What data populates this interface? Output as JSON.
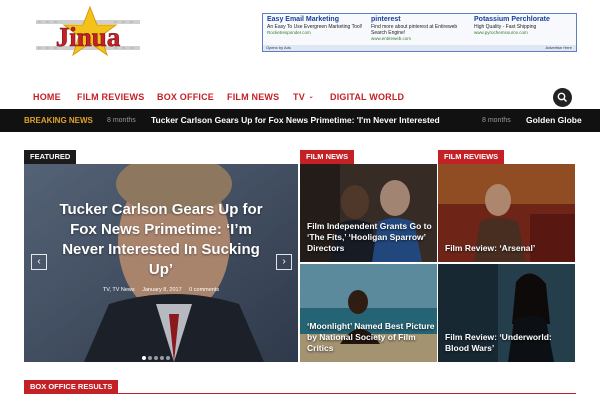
{
  "header": {
    "logo_text": "Jinua"
  },
  "ad": {
    "columns": [
      {
        "title": "Easy Email Marketing",
        "desc": "An Easy To Use Evergreen Marketing Tool!",
        "url": "Rocketresponder.com"
      },
      {
        "title": "pinterest",
        "desc": "Find more about pinterest at Entireweb Search Engine!",
        "url": "www.entireweb.com"
      },
      {
        "title": "Potassium Perchlorate",
        "desc": "High Quality - Fast Shipping",
        "url": "www.pyrochemsource.com"
      }
    ],
    "footer_left": "Openx by Ads",
    "footer_right": "Advertise Here"
  },
  "nav": {
    "items": [
      {
        "label": "HOME"
      },
      {
        "label": "FILM REVIEWS"
      },
      {
        "label": "BOX OFFICE"
      },
      {
        "label": "FILM NEWS"
      },
      {
        "label": "TV"
      },
      {
        "label": "DIGITAL WORLD"
      }
    ]
  },
  "breaking": {
    "label": "BREAKING NEWS",
    "items": [
      {
        "time": "8 months",
        "title": "Tucker Carlson Gears Up for Fox News Primetime: 'I'm Never Interested In"
      },
      {
        "time": "8 months",
        "title": "Golden Globe"
      }
    ]
  },
  "featured": {
    "label": "FEATURED",
    "title": "Tucker Carlson Gears Up for Fox News Primetime: ‘I’m Never Interested In Sucking Up’",
    "categories": "TV, TV News",
    "date": "January 8, 2017",
    "comments": "0 comments",
    "slide_count": 5,
    "active_slide": 1
  },
  "film_news": {
    "label": "FILM NEWS",
    "tiles": [
      {
        "title": "Film Independent Grants Go to ‘The Fits,’ ‘Hooligan Sparrow’ Directors"
      },
      {
        "title": "‘Moonlight’ Named Best Picture by National Society of Film Critics"
      }
    ]
  },
  "film_reviews": {
    "label": "FILM REVIEWS",
    "tiles": [
      {
        "title": "Film Review: ‘Arsenal’"
      },
      {
        "title": "Film Review: ‘Underworld: Blood Wars’"
      }
    ]
  },
  "box_office": {
    "label": "BOX OFFICE RESULTS"
  },
  "colors": {
    "accent": "#c42127",
    "breaking_label": "#e0a128",
    "dark_bar": "#111111"
  }
}
